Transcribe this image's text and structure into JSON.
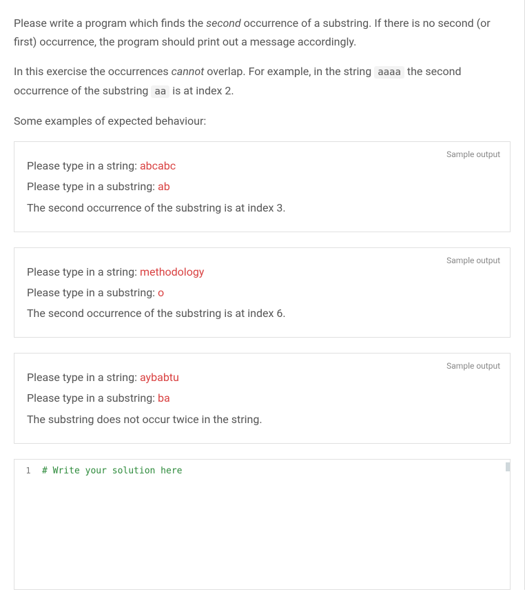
{
  "paragraphs": {
    "p1_a": "Please write a program which finds the ",
    "p1_em": "second",
    "p1_b": " occurrence of a substring. If there is no second (or first) occurrence, the program should print out a message accordingly.",
    "p2_a": "In this exercise the occurrences ",
    "p2_em": "cannot",
    "p2_b": " overlap. For example, in the string ",
    "p2_code1": "aaaa",
    "p2_c": " the second occurrence of the substring ",
    "p2_code2": "aa",
    "p2_d": " is at index 2.",
    "p3": "Some examples of expected behaviour:"
  },
  "sample_label": "Sample output",
  "samples": [
    {
      "lines": [
        {
          "prompt": "Please type in a string: ",
          "input": "abcabc"
        },
        {
          "prompt": "Please type in a substring: ",
          "input": "ab"
        },
        {
          "prompt": "The second occurrence of the substring is at index 3.",
          "input": ""
        }
      ]
    },
    {
      "lines": [
        {
          "prompt": "Please type in a string: ",
          "input": "methodology"
        },
        {
          "prompt": "Please type in a substring: ",
          "input": "o"
        },
        {
          "prompt": "The second occurrence of the substring is at index 6.",
          "input": ""
        }
      ]
    },
    {
      "lines": [
        {
          "prompt": "Please type in a string: ",
          "input": "aybabtu"
        },
        {
          "prompt": "Please type in a substring: ",
          "input": "ba"
        },
        {
          "prompt": "The substring does not occur twice in the string.",
          "input": ""
        }
      ]
    }
  ],
  "editor": {
    "line_number": "1",
    "code": "# Write your solution here"
  }
}
